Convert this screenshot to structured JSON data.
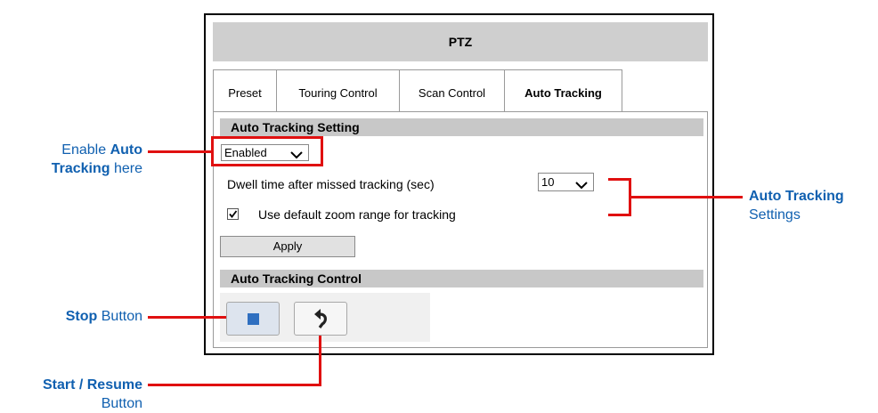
{
  "panel": {
    "title": "PTZ",
    "tabs": [
      {
        "label": "Preset"
      },
      {
        "label": "Touring Control"
      },
      {
        "label": "Scan Control"
      },
      {
        "label": "Auto Tracking"
      }
    ],
    "active_tab": "Auto Tracking",
    "setting_section": {
      "title": "Auto Tracking Setting",
      "enable_select": {
        "value": "Enabled"
      },
      "dwell_label": "Dwell time after missed tracking (sec)",
      "dwell_select": {
        "value": "10"
      },
      "default_zoom_checkbox": {
        "label": "Use default zoom range for tracking",
        "checked": true
      },
      "apply_label": "Apply"
    },
    "control_section": {
      "title": "Auto Tracking Control",
      "stop_icon": "stop-icon",
      "resume_icon": "undo-arrow-icon"
    }
  },
  "annotations": {
    "enable": {
      "prefix": "Enable ",
      "bold": "Auto Tracking",
      "suffix": " here"
    },
    "settings": {
      "bold": "Auto Tracking",
      "line2": "Settings"
    },
    "stop": {
      "bold": "Stop",
      "suffix": " Button"
    },
    "start": {
      "bold": "Start / Resume",
      "line2": "Button"
    }
  },
  "colors": {
    "annotation_text": "#1060b0",
    "callout_red": "#e01010",
    "stop_icon_blue": "#2f6fc0"
  }
}
